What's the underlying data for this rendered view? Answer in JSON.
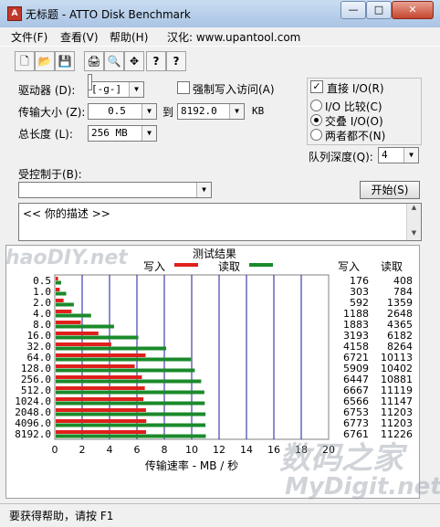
{
  "window": {
    "title": "无标题 - ATTO Disk Benchmark",
    "app_icon": "A"
  },
  "titlebar_buttons": {
    "minimize": "—",
    "maximize": "□",
    "close": "✕"
  },
  "menu": [
    "文件(F)",
    "查看(V)",
    "帮助(H)",
    "汉化: www.upantool.com"
  ],
  "toolbar": [
    "new-icon",
    "open-icon",
    "save-icon",
    "print-icon",
    "print-preview-icon",
    "move-icon",
    "help-icon",
    "context-help-icon"
  ],
  "toolbar_glyphs": [
    "🗋",
    "📂",
    "💾",
    "🖨",
    "🔍",
    "✥",
    "?",
    "?"
  ],
  "form": {
    "drive_label": "驱动器 (D):",
    "drive_value": "[-g-]",
    "force_write_label": "强制写入访问(A)",
    "force_write_checked": false,
    "transfer_label": "传输大小 (Z):",
    "transfer_from": "0.5",
    "to_label": "到",
    "transfer_to": "8192.0",
    "kb_label": "KB",
    "length_label": "总长度 (L):",
    "length_value": "256 MB",
    "direct_io_label": "直接 I/O(R)",
    "direct_io_checked": true,
    "radio_compare": "I/O 比较(C)",
    "radio_overlap": "交叠 I/O(O)",
    "radio_neither": "两者都不(N)",
    "radio_selected": "overlap",
    "queue_label": "队列深度(Q):",
    "queue_value": "4",
    "controlled_label": "受控制于(B):",
    "controlled_value": "",
    "start_button": "开始(S)",
    "description": "<<  你的描述   >>"
  },
  "check_glyph": "✓",
  "dropdown_arrow": "▼",
  "scroll_up": "▲",
  "scroll_down": "▼",
  "chart_data": {
    "type": "bar",
    "title": "测试结果",
    "legend": [
      {
        "name": "写入",
        "color": "#e0201c"
      },
      {
        "name": "读取",
        "color": "#1a8a2a"
      }
    ],
    "categories": [
      "0.5",
      "1.0",
      "2.0",
      "4.0",
      "8.0",
      "16.0",
      "32.0",
      "64.0",
      "128.0",
      "256.0",
      "512.0",
      "1024.0",
      "2048.0",
      "4096.0",
      "8192.0"
    ],
    "series": [
      {
        "name": "写入",
        "values": [
          176,
          303,
          592,
          1188,
          1883,
          3193,
          4158,
          6721,
          5909,
          6447,
          6667,
          6566,
          6753,
          6773,
          6761
        ]
      },
      {
        "name": "读取",
        "values": [
          408,
          784,
          1359,
          2648,
          4365,
          6182,
          8264,
          10113,
          10402,
          10881,
          11119,
          11147,
          11203,
          11203,
          11226
        ]
      }
    ],
    "xlabel": "传输速率 - MB / 秒",
    "xticks": [
      "0",
      "2",
      "4",
      "6",
      "8",
      "10",
      "12",
      "14",
      "16",
      "18",
      "20"
    ],
    "xlim": [
      0,
      20
    ],
    "col_write": "写入",
    "col_read": "读取"
  },
  "status": "要获得帮助，请按 F1",
  "watermarks": {
    "left": "haoDIY.net",
    "right_cn": "数码之家",
    "right_en": "MyDigit.net"
  }
}
